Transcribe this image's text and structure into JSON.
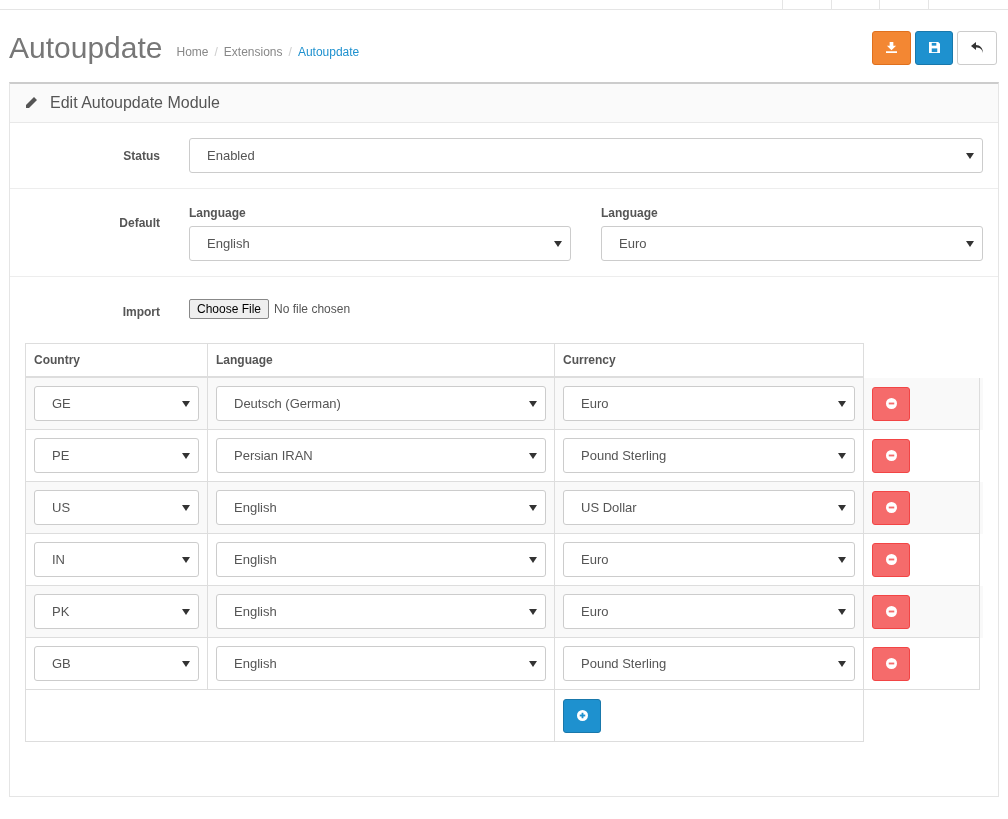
{
  "header": {
    "title": "Autoupdate",
    "separator": "/",
    "breadcrumb": [
      {
        "label": "Home",
        "selected": false
      },
      {
        "label": "Extensions",
        "selected": false
      },
      {
        "label": "Autoupdate",
        "selected": true
      }
    ]
  },
  "panel": {
    "title": "Edit Autoupdate Module"
  },
  "status": {
    "label": "Status",
    "value": "Enabled"
  },
  "default": {
    "label": "Default",
    "fields": [
      {
        "label": "Language",
        "value": "English"
      },
      {
        "label": "Language",
        "value": "Euro"
      }
    ]
  },
  "import": {
    "label": "Import",
    "button": "Choose File",
    "note": "No file chosen"
  },
  "table": {
    "columns": [
      "Country",
      "Language",
      "Currency"
    ],
    "rows": [
      {
        "country": "GE",
        "language": "Deutsch (German)",
        "currency": "Euro"
      },
      {
        "country": "PE",
        "language": "Persian IRAN",
        "currency": "Pound Sterling"
      },
      {
        "country": "US",
        "language": "English",
        "currency": "US Dollar"
      },
      {
        "country": "IN",
        "language": "English",
        "currency": "Euro"
      },
      {
        "country": "PK",
        "language": "English",
        "currency": "Euro"
      },
      {
        "country": "GB",
        "language": "English",
        "currency": "Pound Sterling"
      }
    ]
  }
}
